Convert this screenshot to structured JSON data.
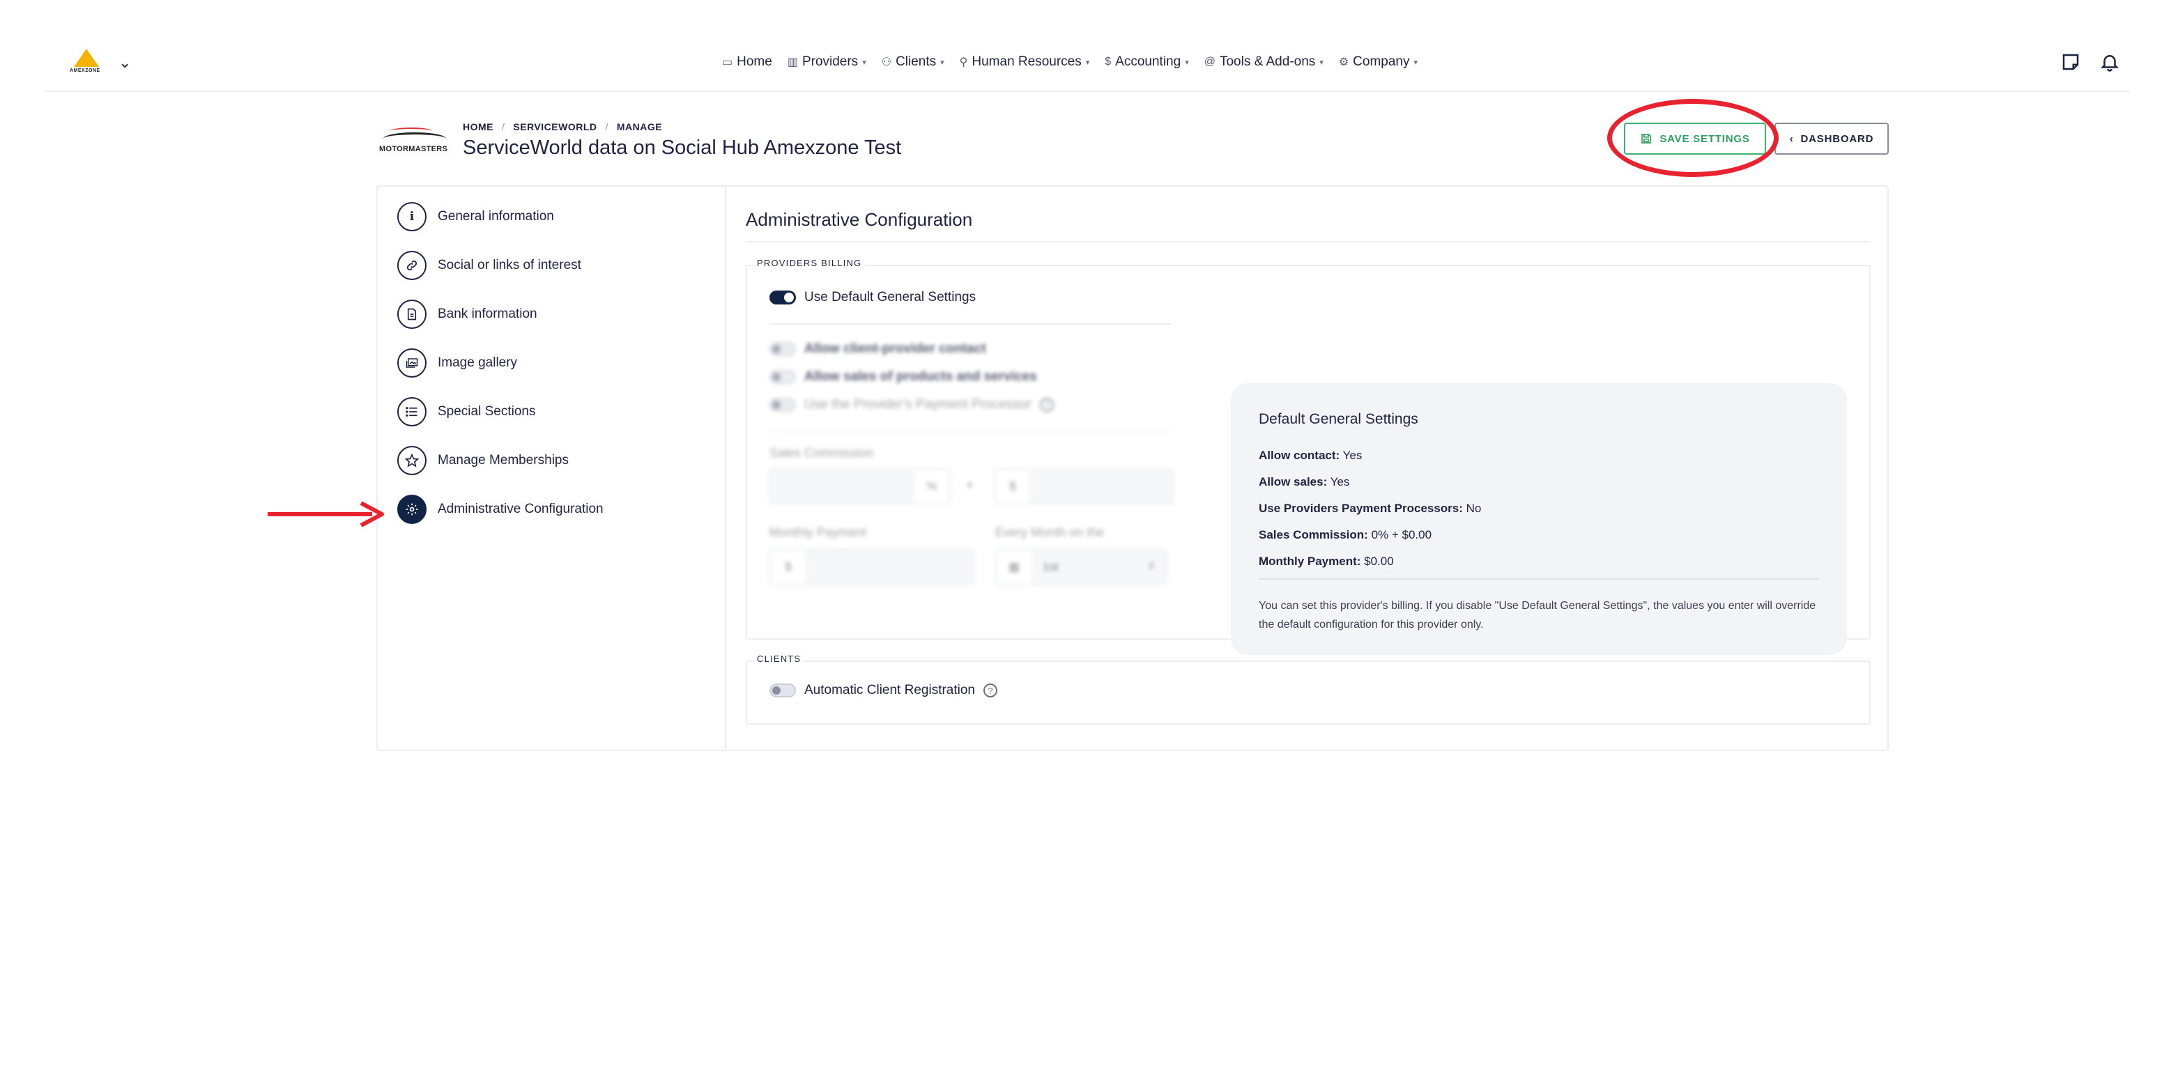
{
  "app": {
    "logo_text": "AMEXZONE"
  },
  "nav": {
    "items": [
      {
        "label": "Home",
        "icon": "monitor-icon",
        "dropdown": false
      },
      {
        "label": "Providers",
        "icon": "building-icon",
        "dropdown": true
      },
      {
        "label": "Clients",
        "icon": "users-icon",
        "dropdown": true
      },
      {
        "label": "Human Resources",
        "icon": "user-plus-icon",
        "dropdown": true
      },
      {
        "label": "Accounting",
        "icon": "dollar-icon",
        "dropdown": true
      },
      {
        "label": "Tools & Add-ons",
        "icon": "at-icon",
        "dropdown": true
      },
      {
        "label": "Company",
        "icon": "gear-icon",
        "dropdown": true
      }
    ]
  },
  "header": {
    "brand_name": "MOTORMASTERS",
    "breadcrumb": [
      "HOME",
      "SERVICEWORLD",
      "MANAGE"
    ],
    "title": "ServiceWorld data on Social Hub Amexzone Test",
    "save_label": "SAVE SETTINGS",
    "dashboard_label": "DASHBOARD"
  },
  "sidebar": {
    "items": [
      {
        "label": "General information",
        "glyph": "i"
      },
      {
        "label": "Social or links of interest",
        "glyph": "🔗"
      },
      {
        "label": "Bank information",
        "glyph": "▤"
      },
      {
        "label": "Image gallery",
        "glyph": "▣"
      },
      {
        "label": "Special Sections",
        "glyph": "☰"
      },
      {
        "label": "Manage Memberships",
        "glyph": "☆"
      },
      {
        "label": "Administrative Configuration",
        "glyph": "⚙"
      }
    ],
    "active_index": 6
  },
  "main": {
    "title": "Administrative Configuration",
    "billing": {
      "legend": "PROVIDERS BILLING",
      "use_default_label": "Use Default General Settings",
      "allow_contact_label": "Allow client-provider contact",
      "allow_sales_label": "Allow sales of products and services",
      "use_processor_label": "Use the Provider's Payment Processor",
      "sales_commission_label": "Sales Commission",
      "percent_addon": "%",
      "plus": "+",
      "dollar_addon": "$",
      "monthly_payment_label": "Monthly Payment",
      "every_month_label": "Every Month on the",
      "every_month_value": "1st"
    },
    "defaults": {
      "title": "Default General Settings",
      "lines": [
        {
          "key": "Allow contact:",
          "value": "Yes"
        },
        {
          "key": "Allow sales:",
          "value": "Yes"
        },
        {
          "key": "Use Providers Payment Processors:",
          "value": "No"
        },
        {
          "key": "Sales Commission:",
          "value": "0% + $0.00"
        },
        {
          "key": "Monthly Payment:",
          "value": "$0.00"
        }
      ],
      "note": "You can set this provider's billing. If you disable \"Use Default General Settings\", the values you enter will override the default configuration for this provider only."
    },
    "clients": {
      "legend": "CLIENTS",
      "auto_reg_label": "Automatic Client Registration"
    }
  }
}
